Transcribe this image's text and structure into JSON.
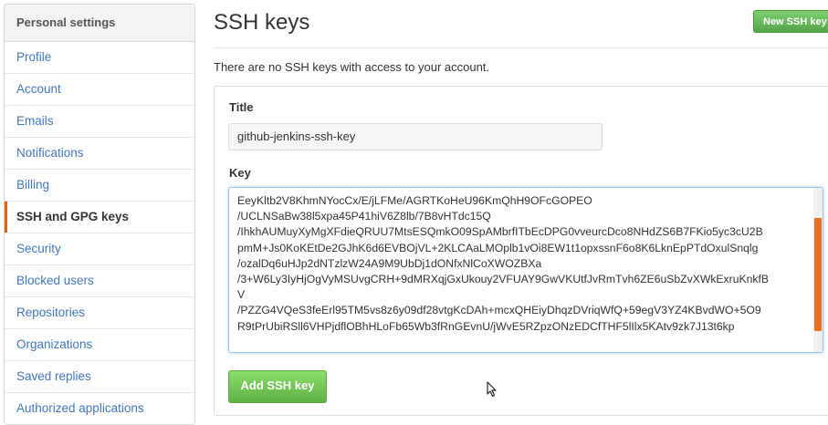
{
  "sidebar": {
    "header": "Personal settings",
    "items": [
      {
        "label": "Profile",
        "active": false
      },
      {
        "label": "Account",
        "active": false
      },
      {
        "label": "Emails",
        "active": false
      },
      {
        "label": "Notifications",
        "active": false
      },
      {
        "label": "Billing",
        "active": false
      },
      {
        "label": "SSH and GPG keys",
        "active": true
      },
      {
        "label": "Security",
        "active": false
      },
      {
        "label": "Blocked users",
        "active": false
      },
      {
        "label": "Repositories",
        "active": false
      },
      {
        "label": "Organizations",
        "active": false
      },
      {
        "label": "Saved replies",
        "active": false
      },
      {
        "label": "Authorized applications",
        "active": false
      }
    ]
  },
  "main": {
    "title": "SSH keys",
    "new_key_button": "New SSH key",
    "empty_message": "There are no SSH keys with access to your account.",
    "form": {
      "title_label": "Title",
      "title_value": "github-jenkins-ssh-key",
      "key_label": "Key",
      "key_value": "EeyKltb2V8KhmNYocCx/E/jLFMe/AGRTKoHeU96KmQhH9OFcGOPEO\n/UCLNSaBw38l5xpa45P41hiV6Z8lb/7B8vHTdc15Q\n/IhkhAUMuyXyMgXFdieQRUU7MtsESQmkO09SpAMbrfITbEcDPG0vveurcDco8NHdZS6B7FKio5yc3cU2B\npmM+Js0KoKEtDe2GJhK6d6EVBOjVL+2KLCAaLMOplb1vOi8EW1t1opxssnF6o8K6LknEpPTdOxulSnqlg\n/ozalDq6uHJp2dNTzlzW24A9M9UbDj1dONfxNlCoXWOZBXa\n/3+W6Ly3IyHjOgVyMSUvgCRH+9dMRXqjGxUkouy2VFUAY9GwVKUtfJvRmTvh6ZE6uSbZvXWkExruKnkfB\nV\n/PZZG4VQeS3feErl95TM5vs8z6y09df28vtgKcDAh+mcxQHEiyDhqzDVriqWfQ+59egV3YZ4KBvdWO+5O9\nR9tPrUbiRSll6VHPjdflOBhHLoFb65Wb3fRnGEvnU/jWvE5RZpzONzEDCfTHF5lIlx5KAtv9zk7J13t6kp",
      "add_button": "Add SSH key"
    }
  },
  "colors": {
    "link": "#4078c0",
    "active_indicator": "#d26911",
    "button_green": "#60b044",
    "scrollbar_thumb": "#e6701f"
  },
  "icons": {
    "cursor": "mouse-pointer-icon"
  }
}
